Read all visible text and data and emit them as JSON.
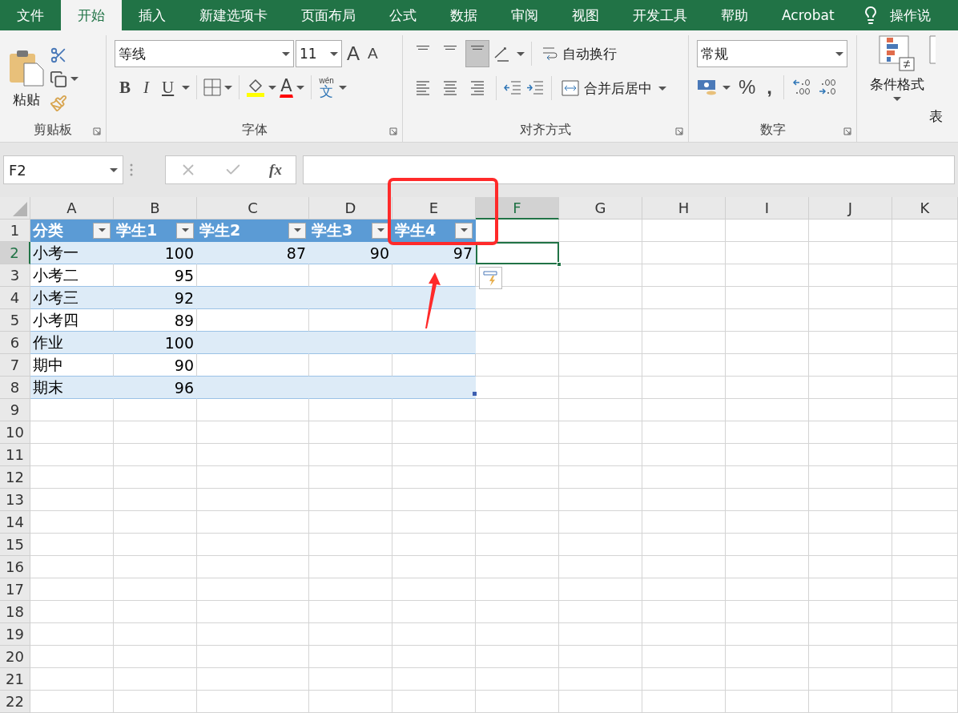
{
  "ribbon_tabs": [
    {
      "label": "文件",
      "selected": false
    },
    {
      "label": "开始",
      "selected": true
    },
    {
      "label": "插入",
      "selected": false
    },
    {
      "label": "新建选项卡",
      "selected": false
    },
    {
      "label": "页面布局",
      "selected": false
    },
    {
      "label": "公式",
      "selected": false
    },
    {
      "label": "数据",
      "selected": false
    },
    {
      "label": "审阅",
      "selected": false
    },
    {
      "label": "视图",
      "selected": false
    },
    {
      "label": "开发工具",
      "selected": false
    },
    {
      "label": "帮助",
      "selected": false
    },
    {
      "label": "Acrobat",
      "selected": false
    }
  ],
  "tell_me": "操作说",
  "insert_function": "fx",
  "clipboard": {
    "paste": "粘贴",
    "group": "剪贴板"
  },
  "font": {
    "name": "等线",
    "size": "11",
    "grow": "A",
    "shrink": "A",
    "bold": "B",
    "italic": "I",
    "underline": "U",
    "font_color": "A",
    "phonetic_top": "wén",
    "phonetic_bottom": "文",
    "group": "字体"
  },
  "alignment": {
    "vertical_align": [
      {
        "selected": false
      },
      {
        "selected": false
      },
      {
        "selected": true
      }
    ],
    "wrap": "自动换行",
    "merge": "合并后居中",
    "group": "对齐方式"
  },
  "number": {
    "format": "常规",
    "percent": "%",
    "comma": ",",
    "group": "数字"
  },
  "styles": {
    "conditional": "条件格式",
    "table_format": "表"
  },
  "name_box": "F2",
  "columns": [
    {
      "label": "A",
      "selected": false
    },
    {
      "label": "B",
      "selected": false
    },
    {
      "label": "C",
      "selected": false
    },
    {
      "label": "D",
      "selected": false
    },
    {
      "label": "E",
      "selected": false
    },
    {
      "label": "F",
      "selected": true
    },
    {
      "label": "G",
      "selected": false
    },
    {
      "label": "H",
      "selected": false
    },
    {
      "label": "I",
      "selected": false
    },
    {
      "label": "J",
      "selected": false
    },
    {
      "label": "K",
      "selected": false
    }
  ],
  "rows": [
    {
      "label": "1",
      "selected": false
    },
    {
      "label": "2",
      "selected": true
    },
    {
      "label": "3",
      "selected": false
    },
    {
      "label": "4",
      "selected": false
    },
    {
      "label": "5",
      "selected": false
    },
    {
      "label": "6",
      "selected": false
    },
    {
      "label": "7",
      "selected": false
    },
    {
      "label": "8",
      "selected": false
    },
    {
      "label": "9",
      "selected": false
    },
    {
      "label": "10",
      "selected": false
    },
    {
      "label": "11",
      "selected": false
    },
    {
      "label": "12",
      "selected": false
    },
    {
      "label": "13",
      "selected": false
    },
    {
      "label": "14",
      "selected": false
    },
    {
      "label": "15",
      "selected": false
    },
    {
      "label": "16",
      "selected": false
    },
    {
      "label": "17",
      "selected": false
    },
    {
      "label": "18",
      "selected": false
    },
    {
      "label": "19",
      "selected": false
    },
    {
      "label": "20",
      "selected": false
    },
    {
      "label": "21",
      "selected": false
    },
    {
      "label": "22",
      "selected": false
    }
  ],
  "table": {
    "headers": [
      "分类",
      "学生1",
      "学生2",
      "学生3",
      "学生4"
    ],
    "rows": [
      [
        "小考一",
        "100",
        "87",
        "90",
        "97"
      ],
      [
        "小考二",
        "95"
      ],
      [
        "小考三",
        "92"
      ],
      [
        "小考四",
        "89"
      ],
      [
        "作业",
        "100"
      ],
      [
        "期中",
        "90"
      ],
      [
        "期末",
        "96"
      ]
    ]
  }
}
